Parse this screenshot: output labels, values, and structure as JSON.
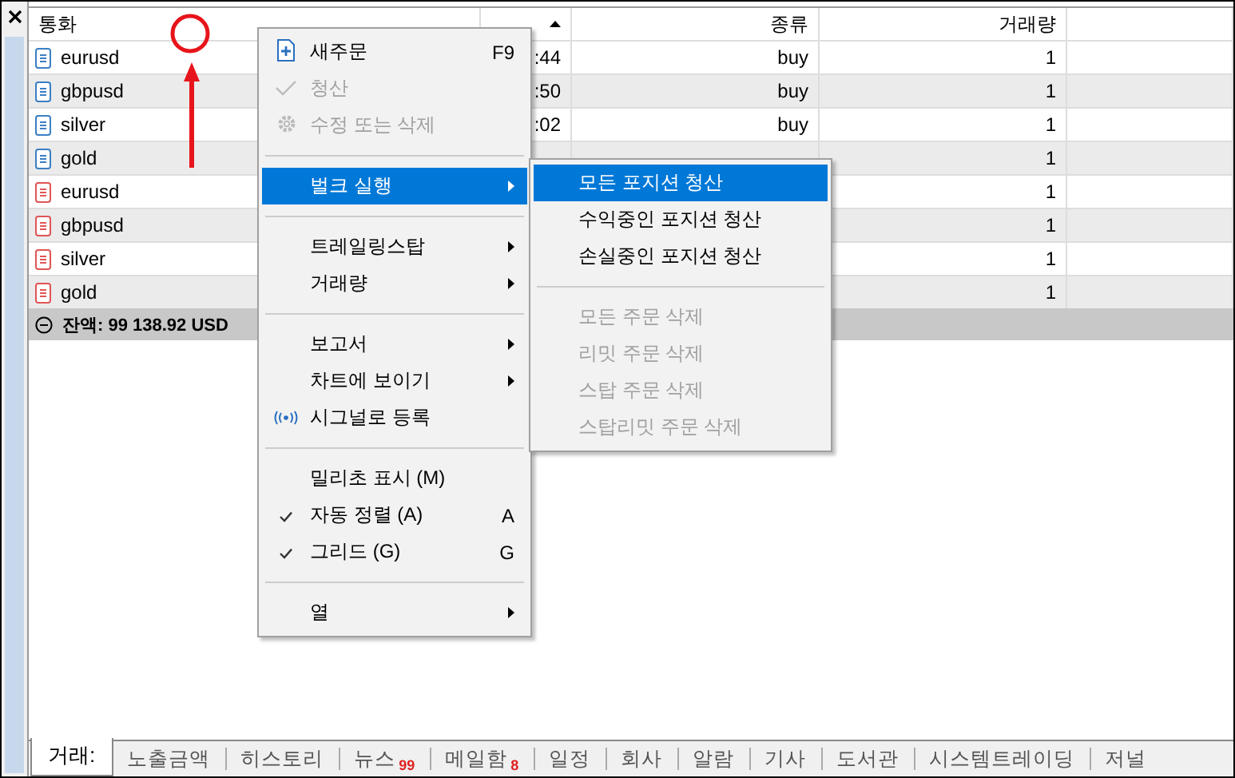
{
  "table": {
    "columns": [
      {
        "label": "통화"
      },
      {
        "sorted": true
      },
      {
        "label": "종류"
      },
      {
        "label": "거래량"
      }
    ],
    "rows": [
      {
        "symbol": "eurusd",
        "color": "#3b7fc4",
        "time": ":44",
        "type": "buy",
        "volume": "1"
      },
      {
        "symbol": "gbpusd",
        "color": "#3b7fc4",
        "time": ":50",
        "type": "buy",
        "volume": "1"
      },
      {
        "symbol": "silver",
        "color": "#3b7fc4",
        "time": ":02",
        "type": "buy",
        "volume": "1"
      },
      {
        "symbol": "gold",
        "color": "#3b7fc4",
        "volume": "1"
      },
      {
        "symbol": "eurusd",
        "color": "#e05555",
        "volume": "1"
      },
      {
        "symbol": "gbpusd",
        "color": "#e05555",
        "volume": "1"
      },
      {
        "symbol": "silver",
        "color": "#e05555",
        "volume": "1"
      },
      {
        "symbol": "gold",
        "color": "#e05555",
        "volume": "1"
      }
    ],
    "balance": "잔액: 99 138.92 USD"
  },
  "context_menu": [
    {
      "kind": "new_order",
      "label": "새주문",
      "shortcut": "F9",
      "disabled": false,
      "selected": false,
      "checked": false,
      "submenu": false
    },
    {
      "kind": "close_position",
      "label": "청산",
      "disabled": true,
      "selected": false,
      "checked": false,
      "submenu": false
    },
    {
      "kind": "modify",
      "label": "수정 또는 삭제",
      "disabled": true,
      "selected": false,
      "checked": false,
      "submenu": false
    },
    {
      "kind": "separator"
    },
    {
      "kind": "item",
      "label": "벌크 실행",
      "disabled": false,
      "selected": true,
      "checked": false,
      "submenu": true
    },
    {
      "kind": "separator"
    },
    {
      "kind": "item",
      "label": "트레일링스탑",
      "disabled": false,
      "selected": false,
      "checked": false,
      "submenu": true
    },
    {
      "kind": "item",
      "label": "거래량",
      "disabled": false,
      "selected": false,
      "checked": false,
      "submenu": true
    },
    {
      "kind": "separator"
    },
    {
      "kind": "item",
      "label": "보고서",
      "disabled": false,
      "selected": false,
      "checked": false,
      "submenu": true
    },
    {
      "kind": "item",
      "label": "차트에 보이기",
      "disabled": false,
      "selected": false,
      "checked": false,
      "submenu": true
    },
    {
      "kind": "signal",
      "label": "시그널로 등록",
      "disabled": false,
      "selected": false,
      "checked": false,
      "submenu": false
    },
    {
      "kind": "separator"
    },
    {
      "kind": "item",
      "label": "밀리초 표시 (M)",
      "disabled": false,
      "selected": false,
      "checked": false,
      "submenu": false
    },
    {
      "kind": "item",
      "label": "자동 정렬 (A)",
      "shortcut": "A",
      "disabled": false,
      "selected": false,
      "checked": true,
      "submenu": false
    },
    {
      "kind": "item",
      "label": "그리드 (G)",
      "shortcut": "G",
      "disabled": false,
      "selected": false,
      "checked": true,
      "submenu": false
    },
    {
      "kind": "separator"
    },
    {
      "kind": "item",
      "label": "열",
      "disabled": false,
      "selected": false,
      "checked": false,
      "submenu": true
    }
  ],
  "submenu": [
    {
      "kind": "item",
      "label": "모든 포지션 청산",
      "disabled": false,
      "selected": true
    },
    {
      "kind": "item",
      "label": "수익중인 포지션 청산",
      "disabled": false,
      "selected": false
    },
    {
      "kind": "item",
      "label": "손실중인 포지션 청산",
      "disabled": false,
      "selected": false
    },
    {
      "kind": "separator"
    },
    {
      "kind": "item",
      "label": "모든 주문 삭제",
      "disabled": true,
      "selected": false
    },
    {
      "kind": "item",
      "label": "리밋 주문 삭제",
      "disabled": true,
      "selected": false
    },
    {
      "kind": "item",
      "label": "스탑 주문 삭제",
      "disabled": true,
      "selected": false
    },
    {
      "kind": "item",
      "label": "스탑리밋 주문 삭제",
      "disabled": true,
      "selected": false
    }
  ],
  "tabs": [
    {
      "label": "거래:",
      "selected": true
    },
    {
      "label": "노출금액",
      "selected": false
    },
    {
      "label": "히스토리",
      "selected": false
    },
    {
      "label": "뉴스",
      "badge": "99",
      "selected": false
    },
    {
      "label": "메일함",
      "badge": "8",
      "selected": false
    },
    {
      "label": "일정",
      "selected": false
    },
    {
      "label": "회사",
      "selected": false
    },
    {
      "label": "알람",
      "selected": false
    },
    {
      "label": "기사",
      "selected": false
    },
    {
      "label": "도서관",
      "selected": false
    },
    {
      "label": "시스템트레이딩",
      "selected": false
    },
    {
      "label": "저널",
      "selected": false
    }
  ]
}
